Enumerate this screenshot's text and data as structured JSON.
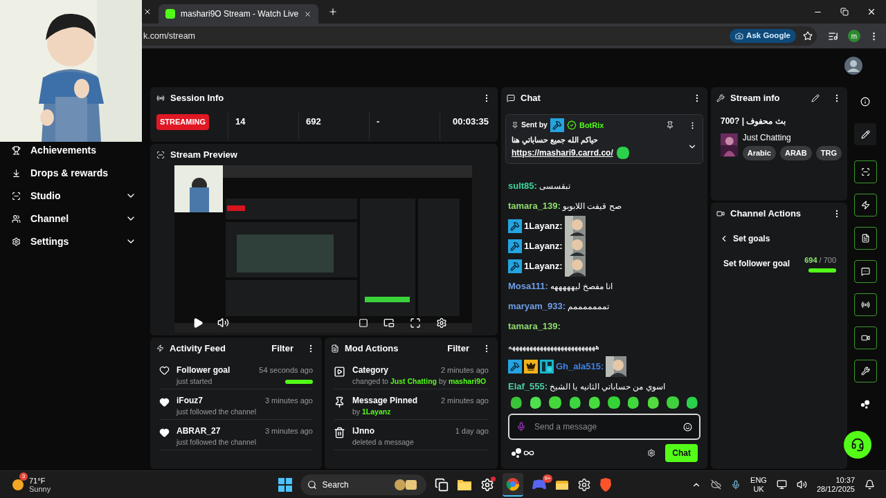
{
  "browser": {
    "tab": {
      "title": "mashari9O Stream - Watch Live",
      "selected": true
    },
    "address": "k.com/stream",
    "ask_button": "Ask Google",
    "profile_initial": "m"
  },
  "sidebar": {
    "items": [
      {
        "label": "Achievements"
      },
      {
        "label": "Drops & rewards"
      },
      {
        "label": "Studio",
        "expanded": false
      },
      {
        "label": "Channel",
        "expanded": false
      },
      {
        "label": "Settings",
        "expanded": false
      }
    ]
  },
  "session_info": {
    "title": "Session Info",
    "status": "STREAMING",
    "stats": [
      "14",
      "692",
      "-",
      "00:03:35"
    ]
  },
  "stream_preview": {
    "title": "Stream Preview"
  },
  "activity_feed": {
    "title": "Activity Feed",
    "filter": "Filter",
    "items": [
      {
        "kind": "goal",
        "name": "Follower goal",
        "detail": "just started",
        "time": "54 seconds ago",
        "level": 0.99
      },
      {
        "kind": "follow",
        "name": "iFouz7",
        "detail": "just followed the channel",
        "time": "3 minutes ago"
      },
      {
        "kind": "follow",
        "name": "ABRAR_27",
        "detail": "just followed the channel",
        "time": "3 minutes ago"
      }
    ]
  },
  "mod_actions": {
    "title": "Mod Actions",
    "filter": "Filter",
    "items": [
      {
        "kind": "category",
        "name": "Category",
        "time": "2 minutes ago",
        "detail": [
          {
            "text": "changed to",
            "highlight": false
          },
          {
            "text": "Just Chatting",
            "highlight": true
          },
          {
            "text": "by",
            "highlight": false
          },
          {
            "text": "mashari9O",
            "highlight": true
          }
        ]
      },
      {
        "kind": "pin",
        "name": "Message Pinned",
        "time": "2 minutes ago",
        "detail": [
          {
            "text": "by",
            "highlight": false
          },
          {
            "text": "1Layanz",
            "highlight": true
          }
        ]
      },
      {
        "kind": "delete",
        "name": "lJnno",
        "time": "1 day ago",
        "detail": [
          {
            "text": "deleted a message",
            "highlight": false
          }
        ]
      }
    ]
  },
  "chat": {
    "title": "Chat",
    "pinned": {
      "sent_by": "Sent by",
      "user": "BotRix",
      "text": "حياكم الله جميع حساباتي هنا",
      "link": "https://mashari9.carrd.co/"
    },
    "messages": [
      {
        "kind": "text",
        "user": "sult85:",
        "color": "#3fd69b",
        "text": "تبقسسى"
      },
      {
        "kind": "text",
        "user": "tamara_139:",
        "color": "#8fdc6c",
        "text": "صح قيفت اللابوبو"
      },
      {
        "kind": "picture",
        "user": "1Layanz:",
        "color": "#ffffff",
        "badges": [
          {
            "kind": "mod"
          }
        ]
      },
      {
        "kind": "picture",
        "user": "1Layanz:",
        "color": "#ffffff",
        "badges": [
          {
            "kind": "mod"
          }
        ]
      },
      {
        "kind": "picture",
        "user": "1Layanz:",
        "color": "#ffffff",
        "badges": [
          {
            "kind": "mod"
          }
        ]
      },
      {
        "kind": "text",
        "user": "Mosa111:",
        "color": "#6f9fe8",
        "text": "انا مفصخ ليهههههه"
      },
      {
        "kind": "text",
        "user": "maryam_933:",
        "color": "#6f9fe8",
        "text": "تمممممممم"
      },
      {
        "kind": "text",
        "user": "tamara_139:",
        "color": "#8fdc6c"
      },
      {
        "kind": "continued",
        "text": "هههههههههههههههههههههههههه"
      },
      {
        "kind": "picture",
        "user": "Gh_ala515:",
        "color": "#3f83e6",
        "badges": [
          {
            "kind": "mod"
          },
          {
            "kind": "crown"
          },
          {
            "kind": "og"
          }
        ]
      },
      {
        "kind": "text",
        "user": "Elaf_555:",
        "color": "#4fd1a5",
        "text": "اسوي من حساباتي الثانيه يا الشيخ"
      }
    ],
    "placeholder": "Send a message",
    "send_button": "Chat"
  },
  "stream_info": {
    "title": "Stream info",
    "stream_title": "700? | بث محفوف",
    "category": "Just Chatting",
    "tags": [
      "Arabic",
      "ARAB",
      "TRG"
    ]
  },
  "channel_actions": {
    "title": "Channel Actions",
    "back": "Set goals",
    "goal_label": "Set follower goal",
    "current": "694",
    "target": "/ 700",
    "level": 0.99
  },
  "taskbar": {
    "temperature": "71°F",
    "weather": "Sunny",
    "weather_badge": "3",
    "search": "Search",
    "discord_badge": "9+",
    "language": "ENG",
    "region": "UK",
    "time": "10:37",
    "date": "28/12/2025"
  }
}
